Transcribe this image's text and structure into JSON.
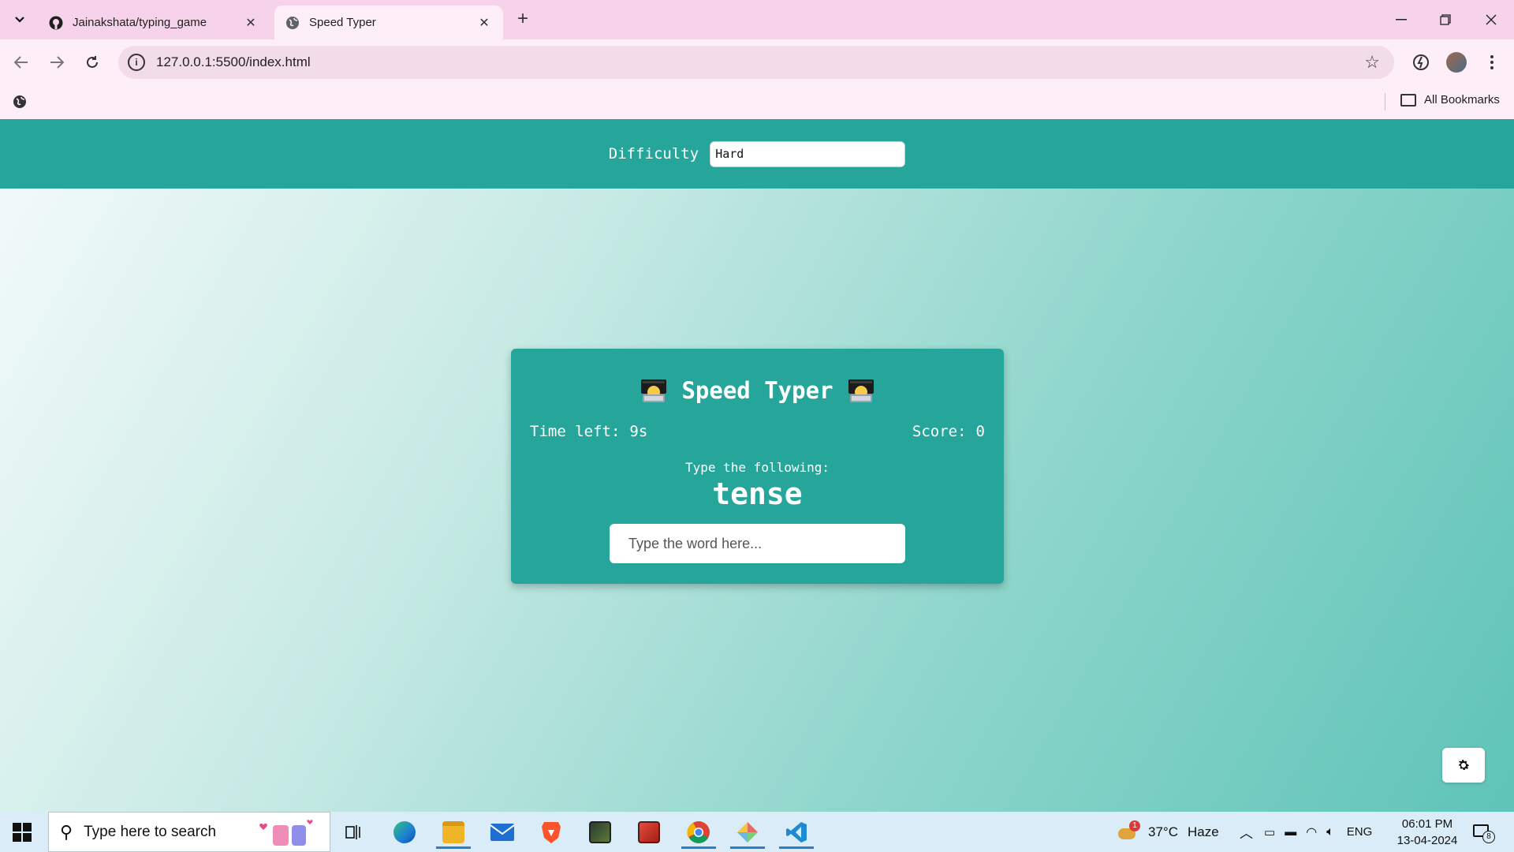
{
  "browser": {
    "tabs": [
      {
        "title": "Jainakshata/typing_game",
        "active": false,
        "icon": "github-icon"
      },
      {
        "title": "Speed Typer",
        "active": true,
        "icon": "globe-icon"
      }
    ],
    "url": "127.0.0.1:5500/index.html",
    "bookmarks_label": "All Bookmarks"
  },
  "page": {
    "difficulty_label": "Difficulty",
    "difficulty_value": "Hard",
    "title": "Speed Typer",
    "time_label": "Time left:",
    "time_value": "9s",
    "score_label": "Score:",
    "score_value": "0",
    "instruction": "Type the following:",
    "word": "tense",
    "input_placeholder": "Type the word here..."
  },
  "taskbar": {
    "search_placeholder": "Type here to search",
    "weather_temp": "37°C",
    "weather_desc": "Haze",
    "weather_alert": "1",
    "language": "ENG",
    "time": "06:01 PM",
    "date": "13-04-2024",
    "notification_count": "8"
  },
  "colors": {
    "accent": "#26a69a",
    "tabstrip": "#f6d3ea",
    "toolbar": "#fdeef8"
  }
}
